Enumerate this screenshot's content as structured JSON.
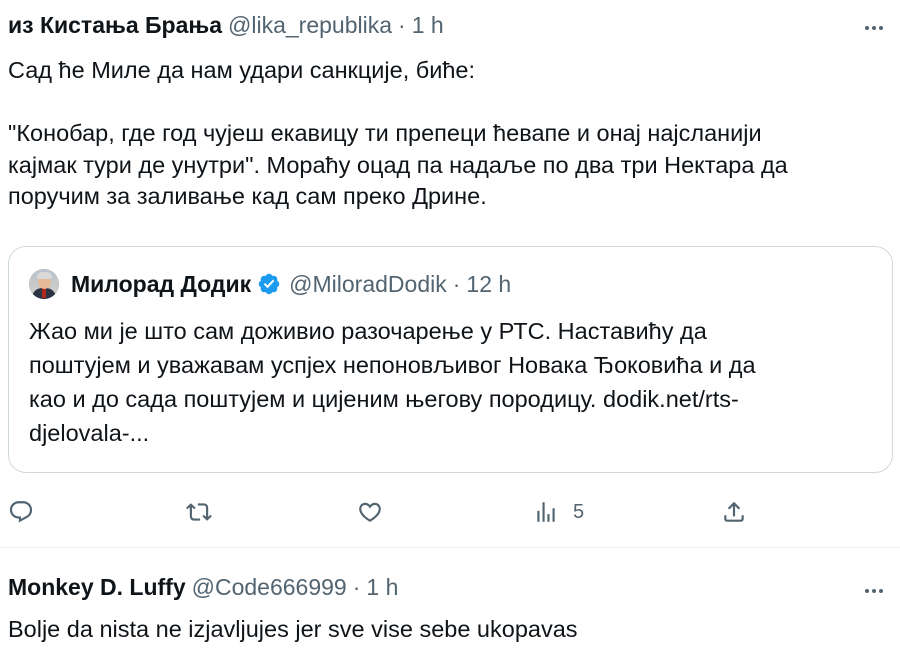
{
  "main_tweet": {
    "display_name": "из Кистања Брања",
    "handle": "@lika_republika",
    "separator": "·",
    "time": "1 h",
    "body_lines": [
      "Сад ће Миле да нам удари санкције, биће:",
      "",
      "\"Конобар, где год чујеш екавицу ти препеци ћевапе и онај најсланији",
      "кајмак тури де унутри\". Мораћу оцад па надаље по два три Нектара да",
      "поручим за заливање кад сам преко Дрине."
    ],
    "quote": {
      "display_name": "Милорад Додик",
      "handle": "@MiloradDodik",
      "separator": "·",
      "time": "12 h",
      "verified_color": "#1d9bf0",
      "body_lines": [
        "Жао ми је што сам доживио разочарење у РТС. Наставићу да",
        "поштујем и уважавам успјех непоновљивог Новака Ђоковића и да",
        "као и до сада поштујем и цијеним његову породицу. dodik.net/rts-",
        "djelovala-..."
      ]
    },
    "actions": {
      "reply_icon": "reply-icon",
      "retweet_icon": "retweet-icon",
      "like_icon": "heart-icon",
      "views_icon": "views-icon",
      "views_count": "5",
      "share_icon": "share-icon"
    }
  },
  "reply_tweet": {
    "display_name": "Monkey D. Luffy",
    "handle": "@Code666999",
    "separator": "·",
    "time": "1 h",
    "body": "Bolje da nista ne izjavljujes jer sve vise sebe ukopavas"
  },
  "colors": {
    "text_primary": "#0f1419",
    "text_secondary": "#536471",
    "border": "#cfd9de",
    "divider": "#eff3f4",
    "verified": "#1d9bf0"
  }
}
